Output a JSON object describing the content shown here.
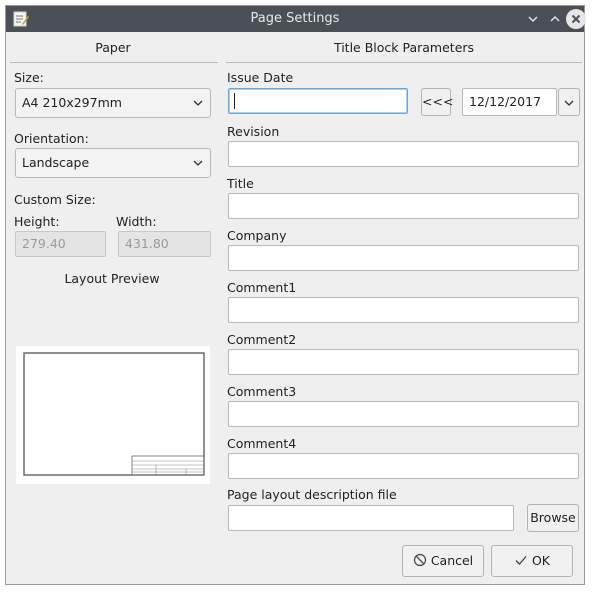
{
  "window": {
    "title": "Page Settings"
  },
  "paper": {
    "header": "Paper",
    "size_label": "Size:",
    "size_value": "A4 210x297mm",
    "orientation_label": "Orientation:",
    "orientation_value": "Landscape",
    "custom_size_label": "Custom Size:",
    "height_label": "Height:",
    "height_value": "279.40",
    "width_label": "Width:",
    "width_value": "431.80",
    "preview_label": "Layout Preview"
  },
  "title_block": {
    "header": "Title Block Parameters",
    "issue_date_label": "Issue Date",
    "issue_date_value": "",
    "copy_date_button": "<<<",
    "date_picker_value": "12/12/2017",
    "revision_label": "Revision",
    "revision_value": "",
    "title_label": "Title",
    "title_value": "",
    "company_label": "Company",
    "company_value": "",
    "comment1_label": "Comment1",
    "comment1_value": "",
    "comment2_label": "Comment2",
    "comment2_value": "",
    "comment3_label": "Comment3",
    "comment3_value": "",
    "comment4_label": "Comment4",
    "comment4_value": "",
    "layout_file_label": "Page layout description file",
    "layout_file_value": "",
    "browse_button": "Browse"
  },
  "footer": {
    "cancel_label": "Cancel",
    "ok_label": "OK"
  },
  "colors": {
    "titlebar": "#4b4f56",
    "dialog_bg": "#efefef",
    "focus_border": "#6aa8dc"
  },
  "icons": [
    "app-icon",
    "minimize-icon",
    "maximize-icon",
    "close-icon",
    "chevron-down-icon",
    "cancel-icon",
    "check-icon"
  ]
}
